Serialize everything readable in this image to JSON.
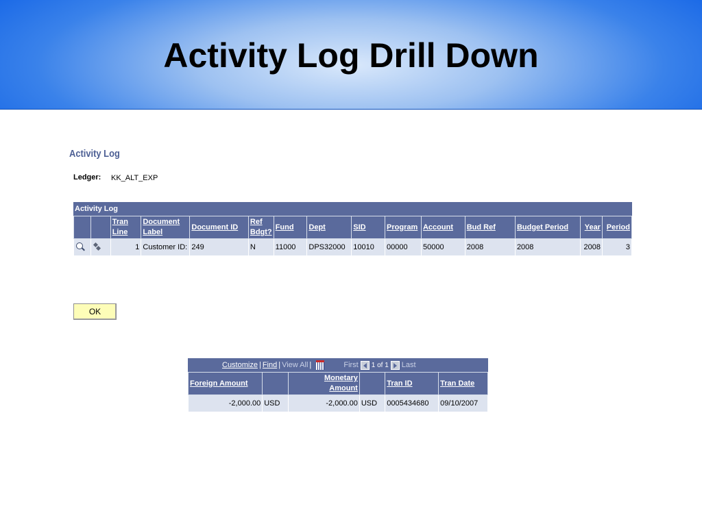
{
  "slide": {
    "title": "Activity Log Drill Down"
  },
  "page": {
    "heading": "Activity Log",
    "ledger_label": "Ledger:",
    "ledger_value": "KK_ALT_EXP"
  },
  "activity_grid": {
    "title": "Activity Log",
    "columns": [
      "Tran Line",
      "Document Label",
      "Document ID",
      "Ref Bdgt?",
      "Fund",
      "Dept",
      "SID",
      "Program",
      "Account",
      "Bud Ref",
      "Budget Period",
      "Year",
      "Period"
    ],
    "header_lines": {
      "tran_line": [
        "Tran",
        "Line"
      ],
      "doc_label": [
        "Document",
        "Label"
      ],
      "ref_bdgt": [
        "Ref",
        "Bdgt?"
      ]
    },
    "row": {
      "icons": [
        "magnify-icon",
        "drill-icon"
      ],
      "tran_line": "1",
      "doc_label": "Customer ID:",
      "doc_id": "249",
      "ref_bdgt": "N",
      "fund": "11000",
      "dept": "DPS32000",
      "sid": "10010",
      "program": "00000",
      "account": "50000",
      "bud_ref": "2008",
      "budget_period": "2008",
      "year": "2008",
      "period": "3"
    }
  },
  "ok_label": "OK",
  "amount_grid": {
    "nav": {
      "customize": "Customize",
      "find": "Find",
      "view_all": "View All",
      "first": "First",
      "count": "1 of 1",
      "last": "Last"
    },
    "columns": [
      "Foreign Amount",
      "",
      "Monetary Amount",
      "",
      "Tran ID",
      "Tran Date"
    ],
    "monetary_lines": [
      "Monetary",
      "Amount"
    ],
    "row": {
      "foreign_amount": "-2,000.00",
      "foreign_currency": "USD",
      "monetary_amount": "-2,000.00",
      "monetary_currency": "USD",
      "tran_id": "0005434680",
      "tran_date": "09/10/2007"
    }
  }
}
